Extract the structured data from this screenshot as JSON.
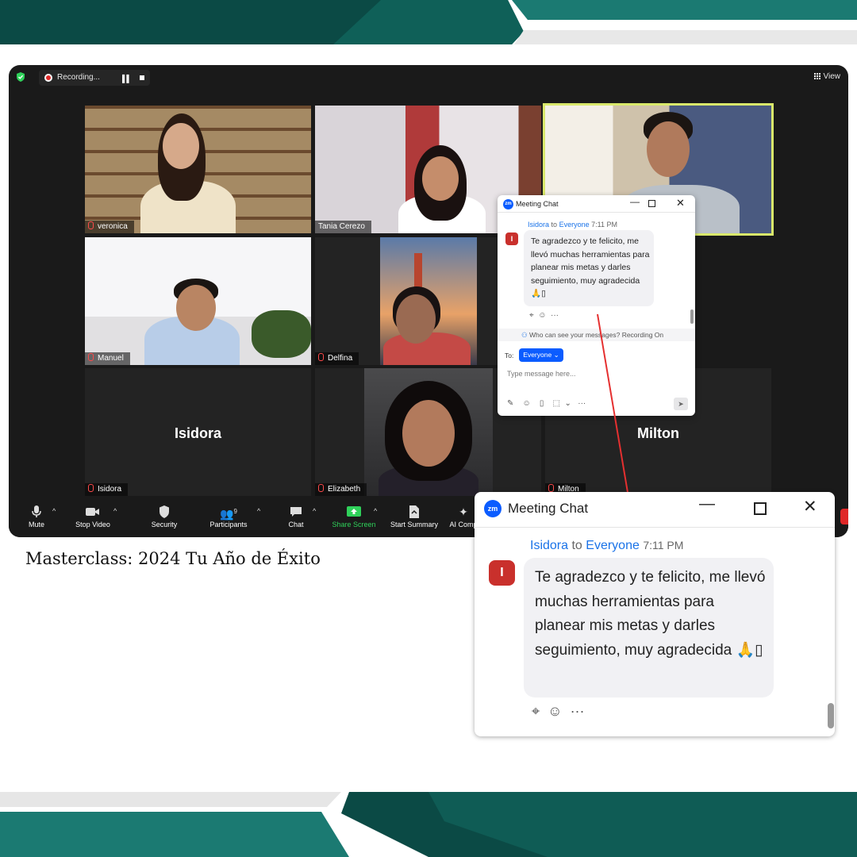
{
  "caption": "Masterclass: 2024 Tu Año de Éxito",
  "topbar": {
    "recording_label": "Recording...",
    "view_label": "View"
  },
  "participants": [
    {
      "name": "veronica",
      "tile": "video"
    },
    {
      "name": "Tania Cerezo",
      "tile": "video"
    },
    {
      "name": "",
      "tile": "video",
      "active_speaker": true
    },
    {
      "name": "Manuel",
      "tile": "video"
    },
    {
      "name": "Delfina",
      "tile": "video"
    },
    {
      "name": "Isidora",
      "tile": "name-only"
    },
    {
      "name": "Elizabeth",
      "tile": "video"
    },
    {
      "name": "Milton",
      "tile": "name-only"
    }
  ],
  "toolbar": {
    "mute": "Mute",
    "stop_video": "Stop Video",
    "security": "Security",
    "participants": "Participants",
    "participants_count": "9",
    "chat": "Chat",
    "share_screen": "Share Screen",
    "start_summary": "Start Summary",
    "ai_companion": "AI Comp"
  },
  "chat": {
    "window_title": "Meeting Chat",
    "logo_text": "zm",
    "sender": "Isidora",
    "to_word": "to",
    "recipient": "Everyone",
    "time": "7:11 PM",
    "avatar_initial": "I",
    "message": "Te agradezco y te felicito, me llevó muchas herramientas para planear mis metas y darles seguimiento, muy agradecida 🙏▯",
    "visibility_note": "Who can see your messages? Recording On",
    "to_label": "To:",
    "to_selected": "Everyone",
    "input_placeholder": "Type message here..."
  },
  "colors": {
    "teal_dark": "#0b4a45",
    "teal": "#1b7a72",
    "zoom_blue": "#0b5cff",
    "record_red": "#e02828",
    "arrow_red": "#e53030"
  }
}
